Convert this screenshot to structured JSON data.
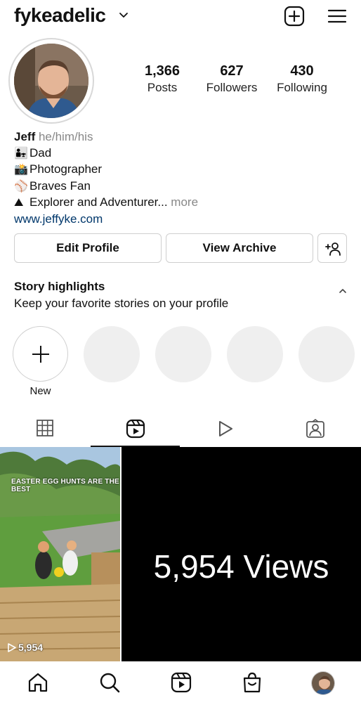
{
  "header": {
    "username": "fykeadelic"
  },
  "profile": {
    "stats": {
      "posts_count": "1,366",
      "posts_label": "Posts",
      "followers_count": "627",
      "followers_label": "Followers",
      "following_count": "430",
      "following_label": "Following"
    },
    "bio": {
      "name": "Jeff",
      "pronouns": "he/him/his",
      "lines": [
        {
          "emoji": "👨‍👧",
          "text": "Dad"
        },
        {
          "emoji": "📸",
          "text": "Photographer"
        },
        {
          "emoji": "⚾",
          "text": "Braves Fan"
        },
        {
          "emoji": "⛰",
          "text": "Explorer and Adventurer..."
        }
      ],
      "more": "more",
      "link": "www.jeffyke.com"
    }
  },
  "buttons": {
    "edit_profile": "Edit Profile",
    "view_archive": "View Archive"
  },
  "highlights": {
    "title": "Story highlights",
    "subtitle": "Keep your favorite stories on your profile",
    "new_label": "New"
  },
  "grid": {
    "thumb_caption": "EASTER EGG HUNTS ARE THE BEST",
    "thumb_views": "5,954",
    "views_tile_text": "5,954 Views"
  },
  "icons": {
    "header": [
      "create-post-icon",
      "menu-icon"
    ],
    "tabs": [
      "posts-grid-icon",
      "reels-icon",
      "videos-play-icon",
      "tagged-icon"
    ],
    "nav": [
      "home-icon",
      "search-icon",
      "reels-icon",
      "shop-icon",
      "profile-avatar"
    ]
  },
  "colors": {
    "link": "#00376b",
    "muted": "#888888",
    "border": "#cfcfcf",
    "highlight_placeholder": "#efefef"
  },
  "state": {
    "active_tab": "reels"
  }
}
